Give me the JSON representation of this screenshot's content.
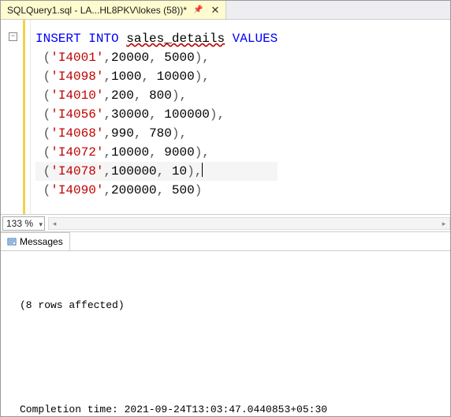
{
  "tab": {
    "title": "SQLQuery1.sql - LA...HL8PKV\\lokes (58))*"
  },
  "sql": {
    "stmt_prefix": "INSERT INTO",
    "table": "sales_details",
    "values_kw": "VALUES",
    "rows": [
      {
        "id": "I4001",
        "a": "20000",
        "b": "5000",
        "trail": ","
      },
      {
        "id": "I4098",
        "a": "1000",
        "b": "10000",
        "trail": ","
      },
      {
        "id": "I4010",
        "a": "200",
        "b": "800",
        "trail": ","
      },
      {
        "id": "I4056",
        "a": "30000",
        "b": "100000",
        "trail": ","
      },
      {
        "id": "I4068",
        "a": "990",
        "b": "780",
        "trail": ","
      },
      {
        "id": "I4072",
        "a": "10000",
        "b": "9000",
        "trail": ","
      },
      {
        "id": "I4078",
        "a": "100000",
        "b": "10",
        "trail": ",",
        "cursor": true
      },
      {
        "id": "I4090",
        "a": "200000",
        "b": "500",
        "trail": ""
      }
    ]
  },
  "zoom": {
    "level": "133 %"
  },
  "results": {
    "tab_label": "Messages",
    "rows_affected": "(8 rows affected)",
    "completion": "Completion time: 2021-09-24T13:03:47.0440853+05:30"
  }
}
